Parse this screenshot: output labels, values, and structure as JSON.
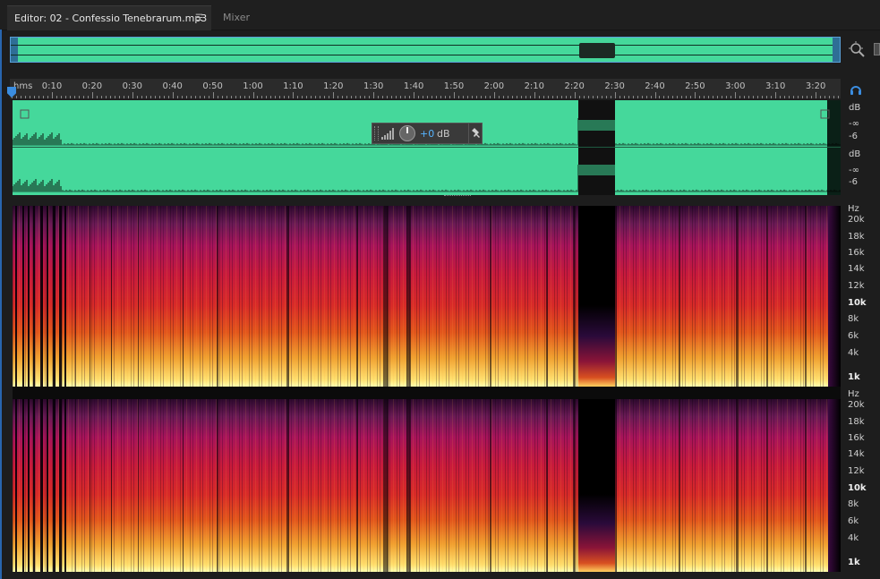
{
  "tabs": {
    "editor_label": "Editor: 02 - Confessio Tenebrarum.mp3",
    "mixer_label": "Mixer",
    "menu_icon": "hamburger-menu-icon"
  },
  "ruler": {
    "unit_label": "hms",
    "ticks": [
      "0:10",
      "0:20",
      "0:30",
      "0:40",
      "0:50",
      "1:00",
      "1:10",
      "1:20",
      "1:30",
      "1:40",
      "1:50",
      "2:00",
      "2:10",
      "2:20",
      "2:30",
      "2:40",
      "2:50",
      "3:00",
      "3:10",
      "3:20"
    ]
  },
  "hud": {
    "gain_value": "+0",
    "gain_unit": "dB"
  },
  "db_scale": {
    "unit": "dB",
    "labels": [
      "-∞",
      "-6"
    ]
  },
  "hz_scale": {
    "unit": "Hz",
    "labels": [
      "20k",
      "18k",
      "16k",
      "14k",
      "12k",
      "10k",
      "8k",
      "6k",
      "4k",
      "1k"
    ]
  },
  "colors": {
    "waveform": "#45d89b",
    "accent": "#3b8de0",
    "gain_value": "#56b4ff"
  },
  "icons": [
    "zoom-icon",
    "headphone-icon",
    "pin-icon",
    "level-bars-icon",
    "gain-knob-icon"
  ]
}
